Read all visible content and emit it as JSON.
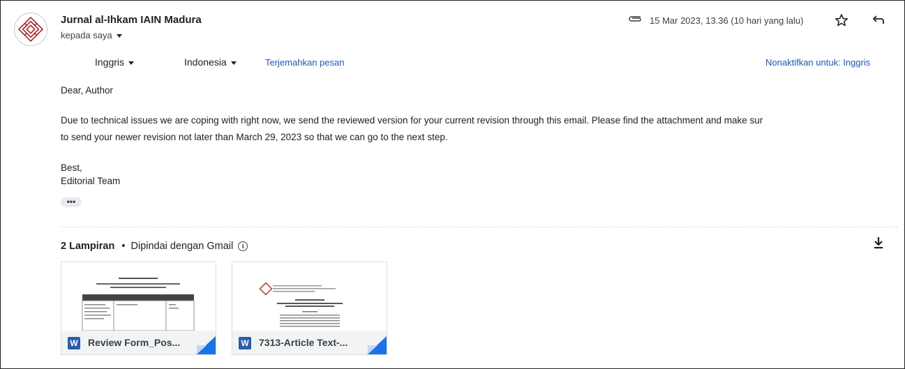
{
  "sender": {
    "name": "Jurnal al-Ihkam IAIN Madura",
    "to": "kepada saya"
  },
  "header": {
    "date": "15 Mar 2023, 13.36 (10 hari yang lalu)",
    "icons": [
      "attachment-icon",
      "star-icon",
      "reply-icon"
    ]
  },
  "translate": {
    "from": "Inggris",
    "to": "Indonesia",
    "translate_link": "Terjemahkan pesan",
    "disable_link": "Nonaktifkan untuk: Inggris"
  },
  "message": {
    "greeting": "Dear, Author",
    "para_line1": "Due to technical issues we are coping with right now, we send the reviewed version for your current revision through this email. Please find the attachment and make sur",
    "para_line2": "to send your newer revision not later than March 29, 2023 so that we can go to the next step.",
    "closing": "Best,",
    "signature": "Editorial Team",
    "more": "•••"
  },
  "attachments": {
    "count_label": "2 Lampiran",
    "separator": "•",
    "scan_label": "Dipindai dengan Gmail",
    "files": [
      {
        "name": "Review Form_Pos...",
        "type_icon": "W"
      },
      {
        "name": "7313-Article Text-...",
        "type_icon": "W"
      }
    ]
  },
  "colors": {
    "link": "#1a57c9",
    "word": "#2a5caa",
    "corner": "#1a73e8",
    "brand": "#a4282d"
  }
}
